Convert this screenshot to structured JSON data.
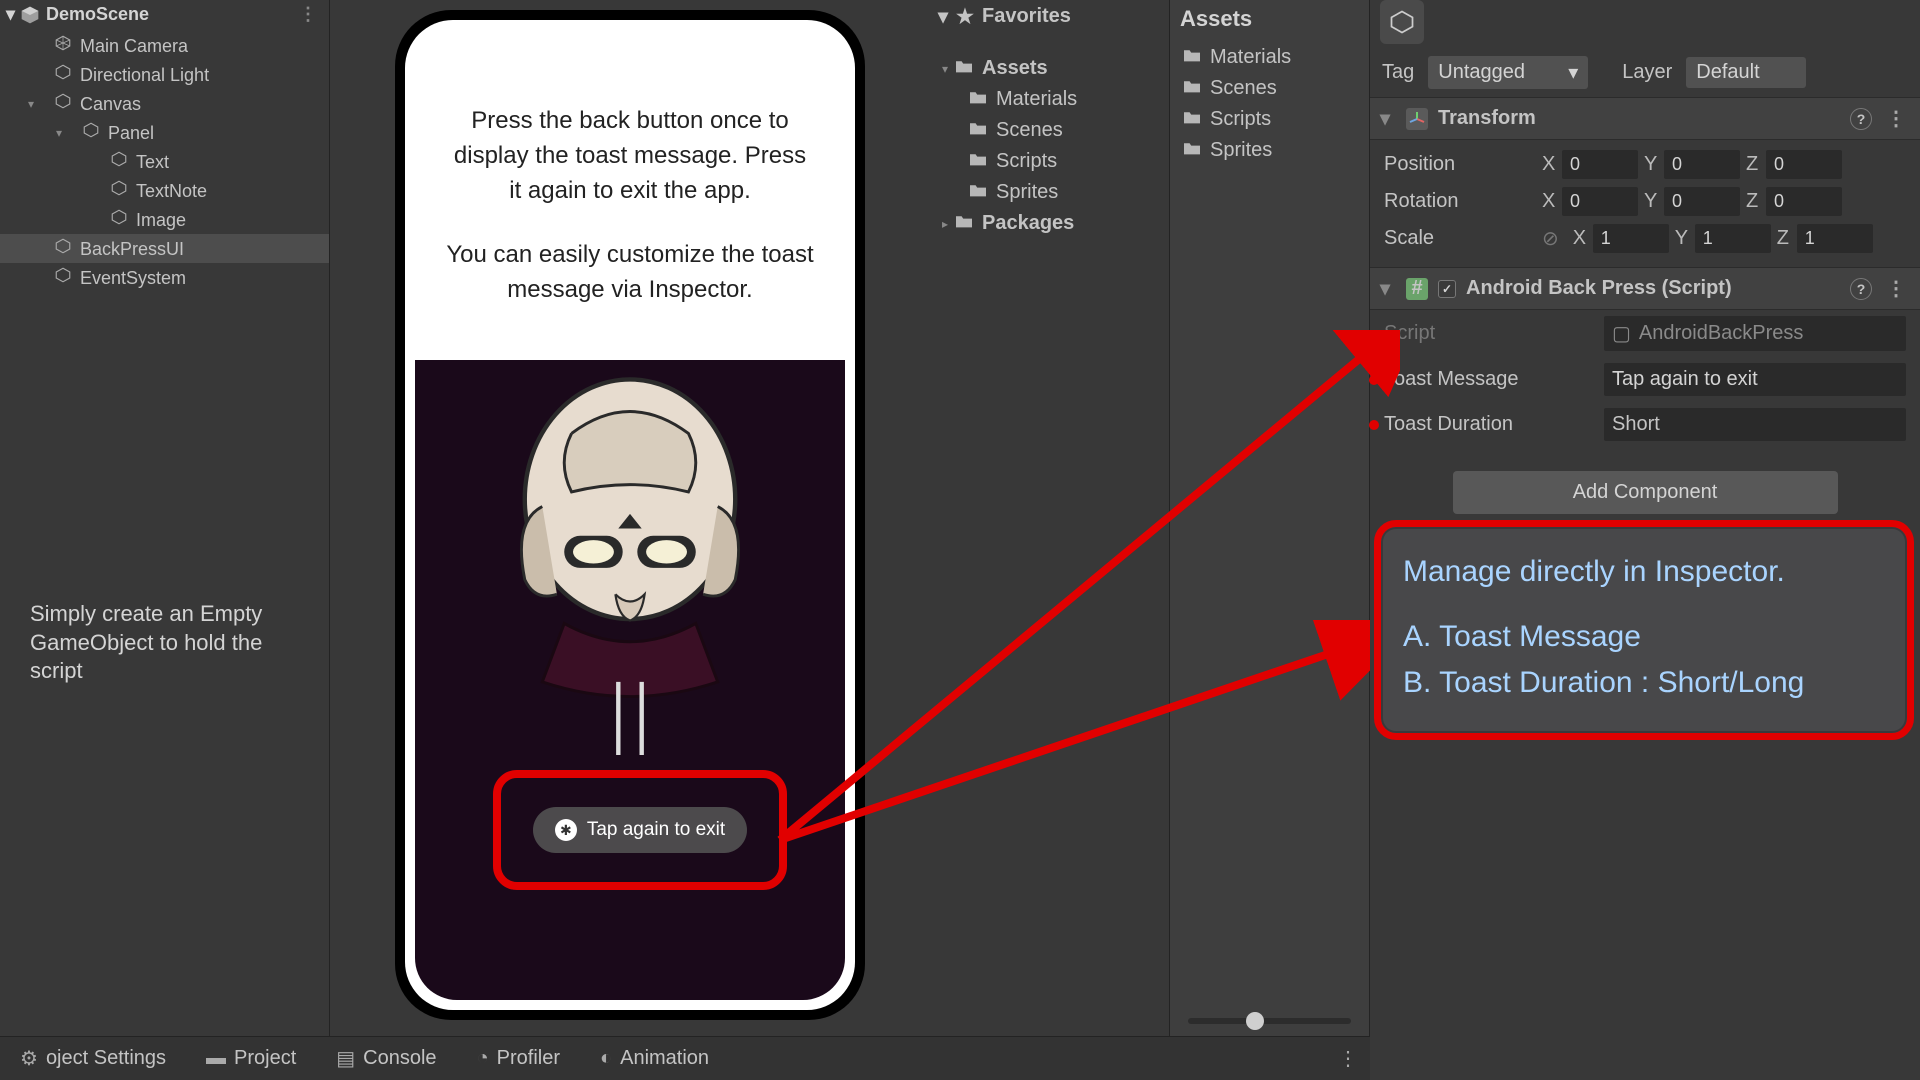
{
  "hierarchy": {
    "scene": "DemoScene",
    "items": [
      {
        "label": "Main Camera",
        "depth": 1
      },
      {
        "label": "Directional Light",
        "depth": 1
      },
      {
        "label": "Canvas",
        "depth": 1,
        "expanded": true
      },
      {
        "label": "Panel",
        "depth": 2,
        "expanded": true
      },
      {
        "label": "Text",
        "depth": 3
      },
      {
        "label": "TextNote",
        "depth": 3
      },
      {
        "label": "Image",
        "depth": 3
      },
      {
        "label": "BackPressUI",
        "depth": 1,
        "selected": true
      },
      {
        "label": "EventSystem",
        "depth": 1
      }
    ],
    "note": "Simply create an Empty GameObject to hold the script"
  },
  "phone": {
    "text1": "Press the back button once to display the toast message. Press it again to exit the app.",
    "text2": "You can easily customize the toast message via Inspector.",
    "toast_label": "Tap again to exit"
  },
  "project_tree": {
    "favorites": "Favorites",
    "assets": "Assets",
    "folders": [
      "Materials",
      "Scenes",
      "Scripts",
      "Sprites"
    ],
    "packages": "Packages"
  },
  "project_grid": {
    "header": "Assets",
    "items": [
      "Materials",
      "Scenes",
      "Scripts",
      "Sprites"
    ]
  },
  "inspector": {
    "tag_label": "Tag",
    "tag_value": "Untagged",
    "layer_label": "Layer",
    "layer_value": "Default",
    "transform": {
      "title": "Transform",
      "position_label": "Position",
      "rotation_label": "Rotation",
      "scale_label": "Scale",
      "pos": {
        "x": "0",
        "y": "0",
        "z": "0"
      },
      "rot": {
        "x": "0",
        "y": "0",
        "z": "0"
      },
      "scl": {
        "x": "1",
        "y": "1",
        "z": "1"
      }
    },
    "script_component": {
      "title": "Android Back Press (Script)",
      "script_label": "Script",
      "script_value": "AndroidBackPress",
      "toast_message_label": "Toast Message",
      "toast_message_value": "Tap again to exit",
      "toast_duration_label": "Toast Duration",
      "toast_duration_value": "Short"
    },
    "add_component": "Add Component"
  },
  "callout": {
    "line1": "Manage directly in Inspector.",
    "lineA": "A. Toast Message",
    "lineB": "B. Toast Duration : Short/Long"
  },
  "bottom_tabs": {
    "items": [
      "oject Settings",
      "Project",
      "Console",
      "Profiler",
      "Animation"
    ]
  },
  "axis_labels": {
    "x": "X",
    "y": "Y",
    "z": "Z"
  }
}
